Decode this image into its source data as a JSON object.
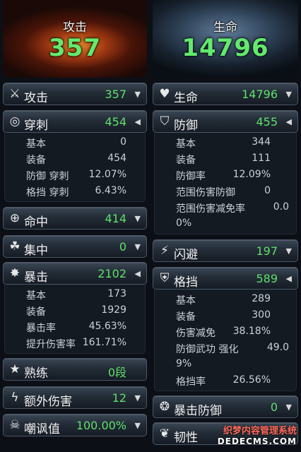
{
  "left": {
    "banner": {
      "title": "攻击",
      "value": "357"
    },
    "attack": {
      "label": "攻击",
      "value": "357",
      "arrow": "▼",
      "icon": "crossed-swords-icon"
    },
    "pierce": {
      "label": "穿刺",
      "value": "454",
      "arrow": "◀",
      "icon": "target-ring-icon",
      "rows": [
        {
          "k": "基本",
          "v": "0"
        },
        {
          "k": "装备",
          "v": "454"
        },
        {
          "k": "防御 穿刺",
          "v": "12.07%"
        },
        {
          "k": "格挡 穿刺",
          "v": "6.43%"
        }
      ]
    },
    "accuracy": {
      "label": "命中",
      "value": "414",
      "arrow": "▼",
      "icon": "crosshair-icon"
    },
    "focus": {
      "label": "集中",
      "value": "0",
      "arrow": "▼",
      "icon": "focus-icon"
    },
    "critical": {
      "label": "暴击",
      "value": "2102",
      "arrow": "◀",
      "icon": "starburst-icon",
      "rows": [
        {
          "k": "基本",
          "v": "173"
        },
        {
          "k": "装备",
          "v": "1929"
        },
        {
          "k": "暴击率",
          "v": "45.63%"
        },
        {
          "k": "提升伤害率",
          "v": "161.71%"
        }
      ]
    },
    "mastery": {
      "label": "熟练",
      "value": "0段",
      "arrow": "",
      "icon": "mastery-star-icon"
    },
    "extra_damage": {
      "label": "额外伤害",
      "value": "12",
      "arrow": "▼",
      "icon": "lightning-icon"
    },
    "taunt": {
      "label": "嘲讽值",
      "value": "100.00%",
      "arrow": "▼",
      "icon": "skull-icon"
    }
  },
  "right": {
    "banner": {
      "title": "生命",
      "value": "14796"
    },
    "hp": {
      "label": "生命",
      "value": "14796",
      "arrow": "▼",
      "icon": "heart-icon"
    },
    "defense": {
      "label": "防御",
      "value": "455",
      "arrow": "◀",
      "icon": "shield-icon",
      "rows": [
        {
          "k": "基本",
          "v": "344"
        },
        {
          "k": "装备",
          "v": "111"
        },
        {
          "k": "防御率",
          "v": "12.09%"
        },
        {
          "k": "范围伤害防御",
          "v": "0"
        },
        {
          "k": "范围伤害减免率",
          "v": "0.0"
        },
        {
          "k": "0%",
          "v": ""
        }
      ]
    },
    "evasion": {
      "label": "闪避",
      "value": "197",
      "arrow": "▼",
      "icon": "dash-icon"
    },
    "block": {
      "label": "格挡",
      "value": "589",
      "arrow": "◀",
      "icon": "block-shield-icon",
      "rows": [
        {
          "k": "基本",
          "v": "289"
        },
        {
          "k": "装备",
          "v": "300"
        },
        {
          "k": "伤害减免",
          "v": "38.18%"
        },
        {
          "k": "防御武功 强化",
          "v": "49.0"
        },
        {
          "k": "9%",
          "v": ""
        },
        {
          "k": "格挡率",
          "v": "26.56%"
        }
      ]
    },
    "crit_defense": {
      "label": "暴击防御",
      "value": "0",
      "arrow": "▼",
      "icon": "crit-defense-icon"
    },
    "tenacity": {
      "label": "韧性",
      "value": "",
      "arrow": "",
      "icon": "tenacity-icon"
    }
  },
  "watermark": {
    "line1": "织梦内容管理系统",
    "line2": "DEDECMS.COM"
  },
  "colors": {
    "value_green": "#5fe06a",
    "banner_green": "#63ea6e",
    "bar_dark": "#161c24"
  }
}
